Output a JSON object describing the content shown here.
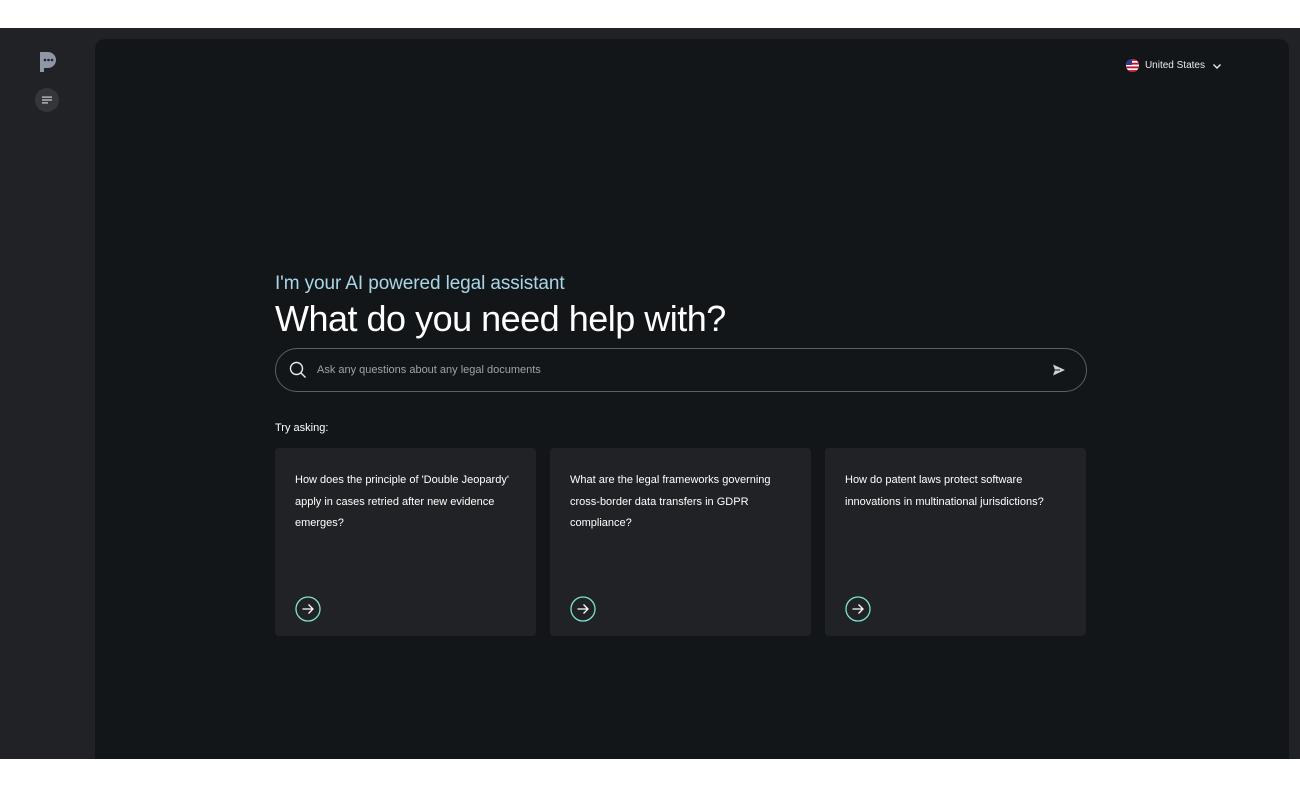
{
  "region_selector": {
    "label": "United States",
    "icon": "us-flag-icon"
  },
  "hero": {
    "subtitle": "I'm your AI powered legal assistant",
    "title": "What do you need help with?"
  },
  "search": {
    "placeholder": "Ask any questions about any legal documents",
    "value": ""
  },
  "suggestions": {
    "label": "Try asking:",
    "items": [
      {
        "text": "How does the principle of 'Double Jeopardy' apply in cases retried after new evidence emerges?"
      },
      {
        "text": "What are the legal frameworks governing cross-border data transfers in GDPR compliance?"
      },
      {
        "text": "How do patent laws protect software innovations in multinational jurisdictions?"
      }
    ]
  },
  "colors": {
    "accent": "#7fe3cf",
    "subtitle": "#a9d6e6",
    "background": "#131619",
    "sidebar": "#212226"
  }
}
